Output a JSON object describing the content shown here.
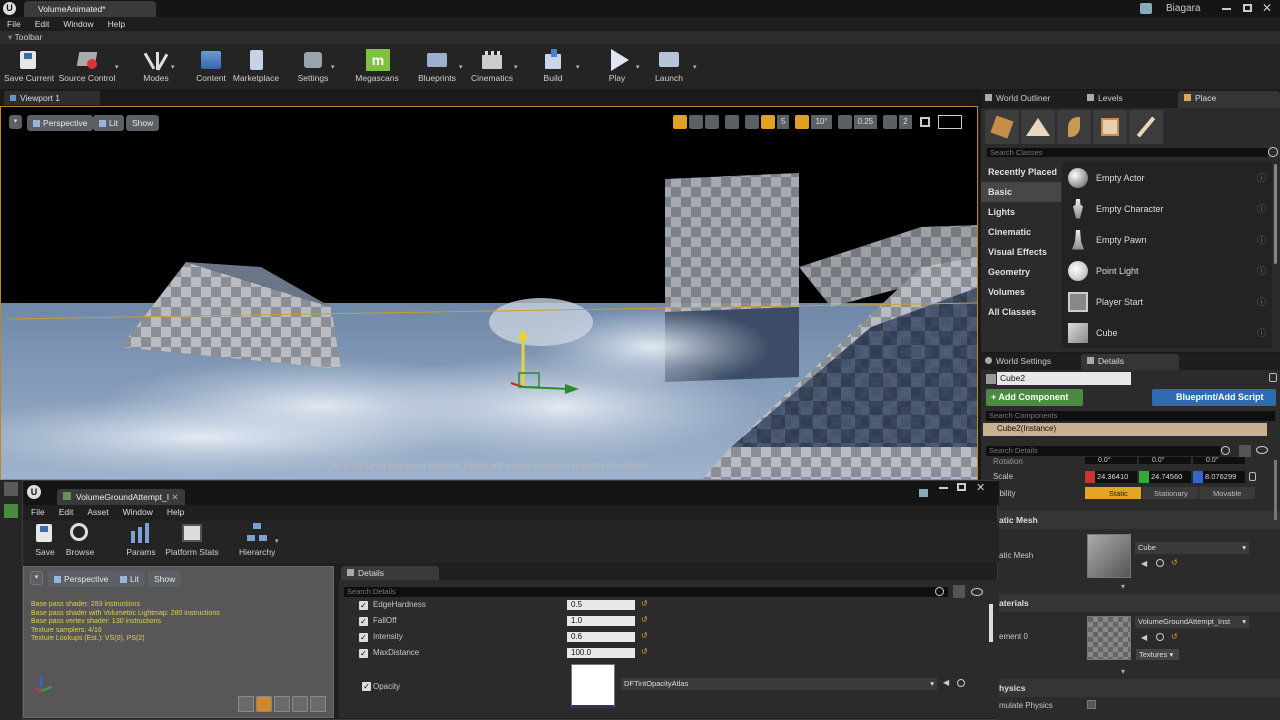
{
  "window": {
    "tab": "VolumeAnimated*",
    "user": "Biagara"
  },
  "menu": [
    "File",
    "Edit",
    "Window",
    "Help"
  ],
  "toolbar": {
    "title": "Toolbar",
    "buttons": [
      {
        "label": "Save Current",
        "icon": "save-icon"
      },
      {
        "label": "Source Control",
        "icon": "source-control-icon"
      },
      {
        "label": "Modes",
        "icon": "modes-icon"
      },
      {
        "label": "Content",
        "icon": "content-icon"
      },
      {
        "label": "Marketplace",
        "icon": "marketplace-icon"
      },
      {
        "label": "Settings",
        "icon": "settings-icon"
      },
      {
        "label": "Megascans",
        "icon": "megascans-icon"
      },
      {
        "label": "Blueprints",
        "icon": "blueprints-icon"
      },
      {
        "label": "Cinematics",
        "icon": "cinematics-icon"
      },
      {
        "label": "Build",
        "icon": "build-icon"
      },
      {
        "label": "Play",
        "icon": "play-icon"
      },
      {
        "label": "Launch",
        "icon": "launch-icon"
      }
    ]
  },
  "viewport": {
    "tab": "Viewport 1",
    "perspective": "Perspective",
    "lit": "Lit",
    "show": "Show",
    "grid_snap": "5",
    "rot_snap": "10°",
    "scale_snap": "0.25",
    "cam_speed": "2",
    "message": "No active Level Sequencer detected. Please edit a Level Sequence to enable full controls."
  },
  "right_tabs": {
    "outliner": "World Outliner",
    "levels": "Levels",
    "place": "Place"
  },
  "place": {
    "search_placeholder": "Search Classes",
    "categories": [
      "Recently Placed",
      "Basic",
      "Lights",
      "Cinematic",
      "Visual Effects",
      "Geometry",
      "Volumes",
      "All Classes"
    ],
    "selected_category": "Basic",
    "items": [
      "Empty Actor",
      "Empty Character",
      "Empty Pawn",
      "Point Light",
      "Player Start",
      "Cube"
    ]
  },
  "details_panel": {
    "tab_world": "World Settings",
    "tab_details": "Details",
    "name": "Cube2",
    "add_component": "+ Add Component",
    "blueprint": "Blueprint/Add Script",
    "search_components": "Search Components",
    "instance": "Cube2(Instance)",
    "search_details": "Search Details",
    "rotation_label": "Rotation",
    "rotation": [
      "0.0°",
      "0.0°",
      "0.0°"
    ],
    "scale_label": "Scale",
    "scale": [
      "24.36410",
      "24.74560",
      "8.076299"
    ],
    "mobility_label": "obility",
    "mobility": [
      "Static",
      "Stationary",
      "Movable"
    ],
    "static_mesh_section": "atic Mesh",
    "static_mesh_label": "atic Mesh",
    "static_mesh_value": "Cube",
    "materials_section": "aterials",
    "element_label": "ement 0",
    "element_value": "VolumeGroundAttempt_Inst",
    "textures_btn": "Textures",
    "physics_section": "hysics",
    "simulate_label": "mulate Physics"
  },
  "mat_editor": {
    "tab": "VolumeGroundAttempt_I",
    "menu": [
      "File",
      "Edit",
      "Asset",
      "Window",
      "Help"
    ],
    "toolbar": [
      {
        "label": "Save",
        "icon": "save-icon"
      },
      {
        "label": "Browse",
        "icon": "browse-icon"
      },
      {
        "label": "Params",
        "icon": "params-icon"
      },
      {
        "label": "Platform Stats",
        "icon": "platform-stats-icon"
      },
      {
        "label": "Hierarchy",
        "icon": "hierarchy-icon"
      }
    ],
    "preview": {
      "perspective": "Perspective",
      "lit": "Lit",
      "show": "Show",
      "stats": [
        "Base pass shader: 283 instructions",
        "Base pass shader with Volumetric Lightmap: 280 instructions",
        "Base pass vertex shader: 130 instructions",
        "Texture samplers: 4/16",
        "Texture Lookups (Est.): VS(0), PS(2)"
      ]
    },
    "details": {
      "tab": "Details",
      "search_placeholder": "Search Details",
      "params": [
        {
          "name": "EdgeHardness",
          "value": "0.5"
        },
        {
          "name": "FallOff",
          "value": "1.0"
        },
        {
          "name": "Intensity",
          "value": "0.6"
        },
        {
          "name": "MaxDistance",
          "value": "100.0"
        }
      ],
      "texture_param": {
        "name": "Opacity",
        "value": "DFTintOpacityAtlas"
      }
    }
  },
  "colors": {
    "accent_green": "#4a8c3f",
    "accent_blue": "#2d6ab4",
    "instance_bg": "#c9b08e",
    "static_yellow": "#e2a622"
  }
}
